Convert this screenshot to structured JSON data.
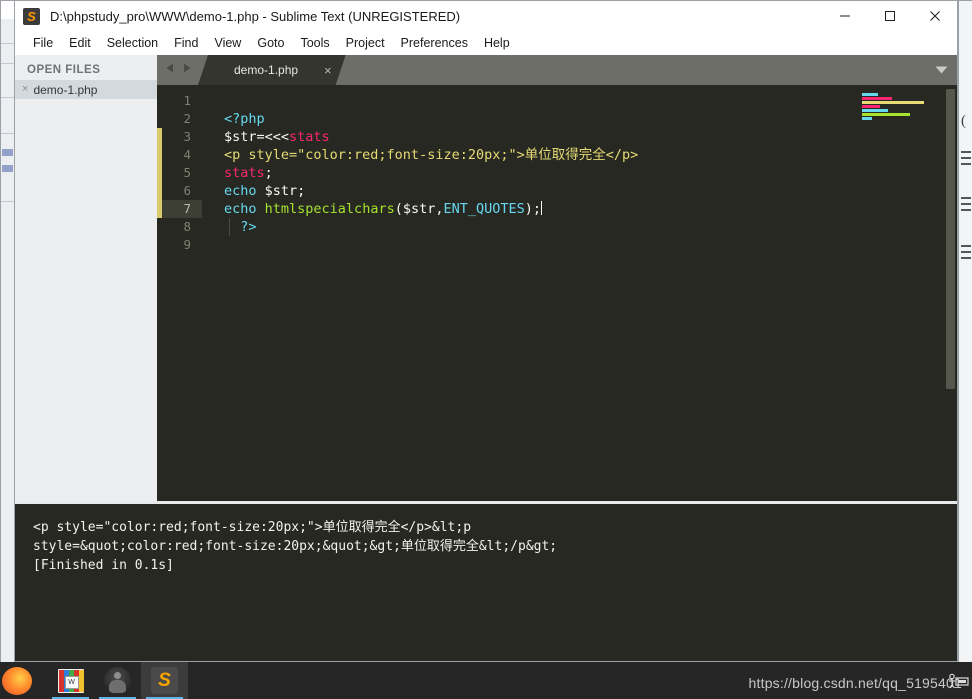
{
  "window": {
    "title": "D:\\phpstudy_pro\\WWW\\demo-1.php - Sublime Text (UNREGISTERED)",
    "app_icon": "sublime-icon",
    "controls": {
      "minimize": "—",
      "maximize": "□",
      "close": "✕"
    }
  },
  "menu": {
    "items": [
      "File",
      "Edit",
      "Selection",
      "Find",
      "View",
      "Goto",
      "Tools",
      "Project",
      "Preferences",
      "Help"
    ]
  },
  "sidebar": {
    "heading": "OPEN FILES",
    "files": [
      {
        "name": "demo-1.php",
        "close": "×"
      }
    ]
  },
  "tabs": {
    "nav_prev": "◀",
    "nav_next": "▶",
    "active": {
      "label": "demo-1.php",
      "close": "×"
    },
    "dropdown": "▼"
  },
  "editor": {
    "line_numbers": [
      "1",
      "2",
      "3",
      "4",
      "5",
      "6",
      "7",
      "8",
      "9"
    ],
    "active_line": 7,
    "marker_lines": [
      3,
      4,
      5,
      6,
      7
    ],
    "lines": [
      {
        "n": 1,
        "tokens": []
      },
      {
        "n": 2,
        "tokens": [
          {
            "t": "<?php",
            "c": "t-cyan"
          }
        ]
      },
      {
        "n": 3,
        "tokens": [
          {
            "t": "$str",
            "c": "t-white"
          },
          {
            "t": "=",
            "c": "t-white"
          },
          {
            "t": "<<<",
            "c": "t-white"
          },
          {
            "t": "stats",
            "c": "t-pink"
          }
        ]
      },
      {
        "n": 4,
        "tokens": [
          {
            "t": "<p style=\"color:red;font-size:20px;\">单位取得完全</p>",
            "c": "t-yellow"
          }
        ]
      },
      {
        "n": 5,
        "tokens": [
          {
            "t": "stats",
            "c": "t-pink"
          },
          {
            "t": ";",
            "c": "t-white"
          }
        ]
      },
      {
        "n": 6,
        "tokens": [
          {
            "t": "echo",
            "c": "t-cyan"
          },
          {
            "t": " $str;",
            "c": "t-white"
          }
        ]
      },
      {
        "n": 7,
        "tokens": [
          {
            "t": "echo",
            "c": "t-cyan"
          },
          {
            "t": " ",
            "c": "t-white"
          },
          {
            "t": "htmlspecialchars",
            "c": "t-green"
          },
          {
            "t": "(",
            "c": "t-white"
          },
          {
            "t": "$str",
            "c": "t-white"
          },
          {
            "t": ",",
            "c": "t-white"
          },
          {
            "t": "ENT_QUOTES",
            "c": "t-cyan"
          },
          {
            "t": ");",
            "c": "t-white"
          }
        ]
      },
      {
        "n": 8,
        "tokens": [
          {
            "t": "  ?>",
            "c": "t-cyan"
          }
        ]
      },
      {
        "n": 9,
        "tokens": []
      }
    ]
  },
  "console": {
    "lines": [
      "<p style=\"color:red;font-size:20px;\">单位取得完全</p>&lt;p",
      "style=&quot;color:red;font-size:20px;&quot;&gt;单位取得完全&lt;/p&gt;",
      "[Finished in 0.1s]"
    ]
  },
  "taskbar": {
    "items": [
      {
        "name": "start-orb",
        "icon": "start-orb-icon",
        "active": false
      },
      {
        "name": "winrar",
        "icon": "winrar-icon",
        "active": false,
        "label": "W"
      },
      {
        "name": "person-app",
        "icon": "person-avatar-icon",
        "active": false
      },
      {
        "name": "sublime-text",
        "icon": "sublime-icon",
        "active": true
      }
    ]
  },
  "watermark": {
    "text": "https://blog.csdn.net/qq_5195401"
  },
  "colors": {
    "editor_bg": "#272822",
    "tab_bar": "#6e6e68",
    "sidebar_bg": "#eceef0",
    "accent_pink": "#f92672",
    "accent_cyan": "#66d9ef",
    "accent_yellow": "#e6db74",
    "accent_green": "#a6e22e",
    "marker": "#d9cb6b",
    "taskbar_bg": "#262626"
  },
  "minimap": {
    "rows": [
      {
        "w": 16,
        "color": "#66d9ef"
      },
      {
        "w": 30,
        "color": "#f92672"
      },
      {
        "w": 62,
        "color": "#e6db74"
      },
      {
        "w": 18,
        "color": "#f92672"
      },
      {
        "w": 26,
        "color": "#66d9ef"
      },
      {
        "w": 48,
        "color": "#a6e22e"
      },
      {
        "w": 10,
        "color": "#66d9ef"
      }
    ]
  }
}
